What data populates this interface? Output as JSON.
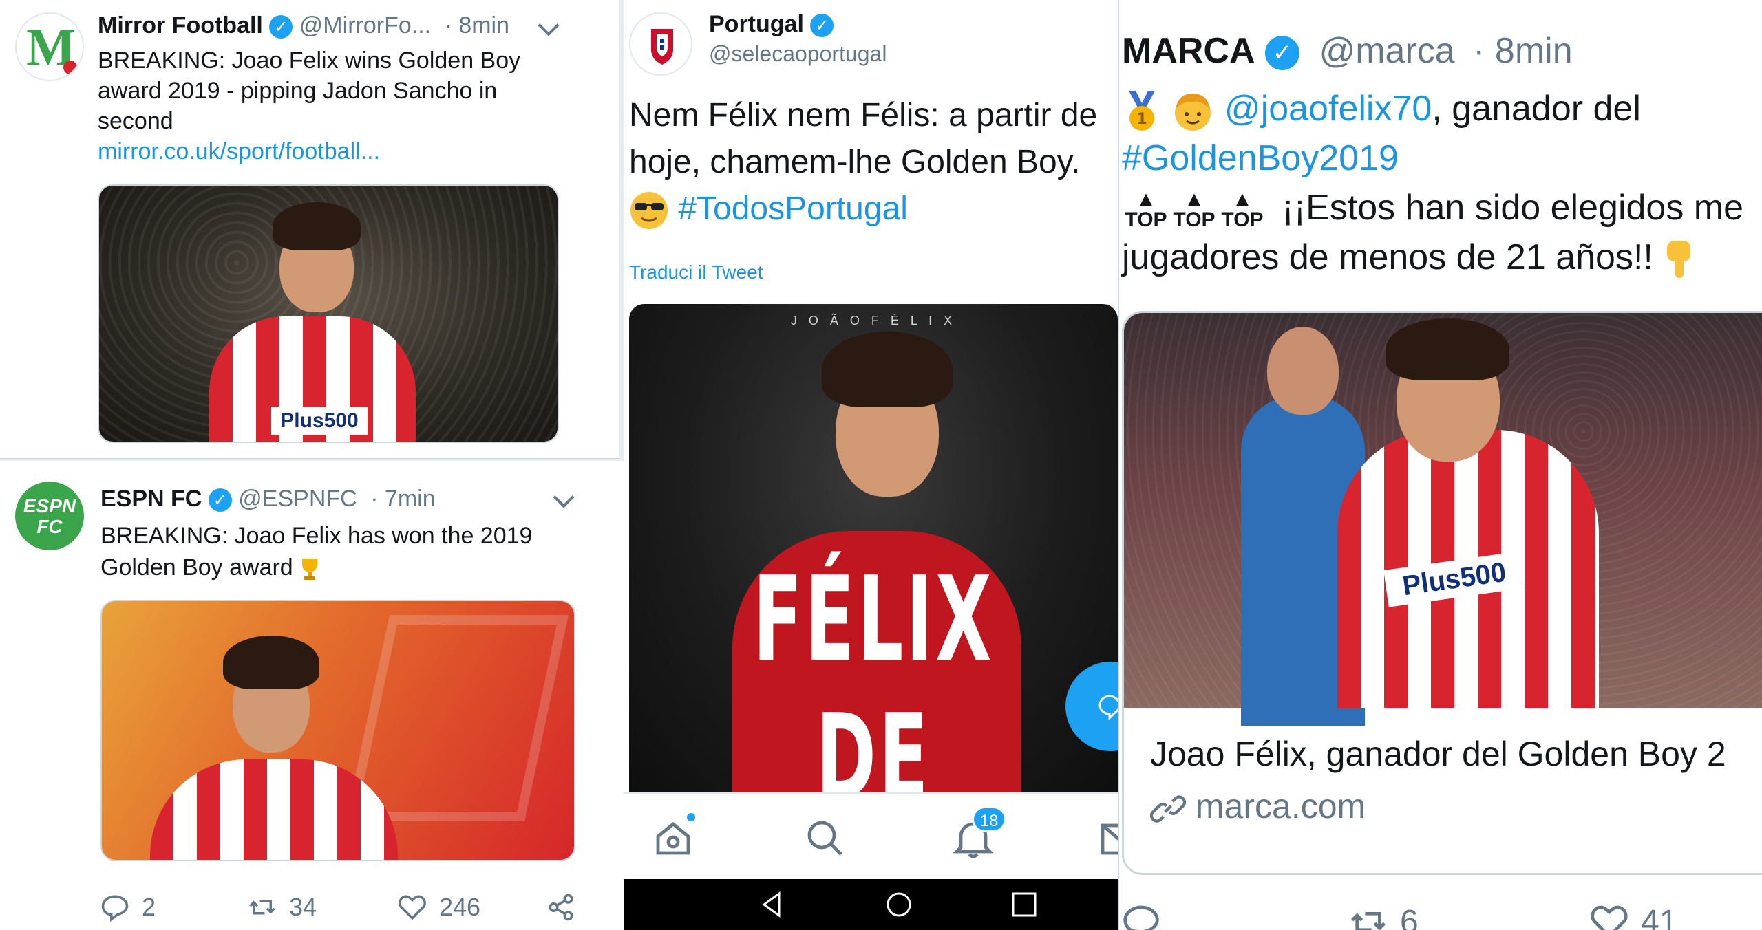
{
  "mirror": {
    "name": "Mirror Football",
    "handle": "@MirrorFo...",
    "time": "· 8min",
    "text1": "BREAKING: Joao Felix wins Golden Boy",
    "text2": "award 2019 - pipping Jadon Sancho in",
    "text3": "second",
    "link": "mirror.co.uk/sport/football...",
    "avatar_letter": "M",
    "sponsor": "Plus500"
  },
  "espn": {
    "name": "ESPN FC",
    "handle": "@ESPNFC",
    "time": "· 7min",
    "text1": "BREAKING: Joao Felix has won the 2019",
    "text2": "Golden Boy award",
    "avatar_text1": "ESPN",
    "avatar_text2": "FC",
    "reply_count": "2",
    "retweet_count": "34",
    "like_count": "246"
  },
  "portugal": {
    "name": "Portugal",
    "handle": "@selecaoportugal",
    "text1": "Nem Félix nem Félis: a partir de",
    "text2": "hoje, chamem-lhe Golden Boy.",
    "hashtag": "#TodosPortugal",
    "translate": "Traduci il Tweet",
    "poster_top": "J O Ã O     F É L I X",
    "poster_line1": "FÉLIX",
    "poster_line2": "DE OURO",
    "notif_count": "18"
  },
  "marca": {
    "name": "MARCA",
    "handle": "@marca",
    "time": "· 8min",
    "mention": "@joaofelix70",
    "text_after_mention": ", ganador del",
    "hashtag": "#GoldenBoy2019",
    "top_label": "TOP",
    "text3": "¡¡Estos han sido elegidos me",
    "text4": "jugadores de menos de 21 años!!",
    "card_title": "Joao Félix, ganador del Golden Boy 2",
    "card_domain": "marca.com",
    "sponsor": "Plus500",
    "retweet_count": "6",
    "like_count": "41"
  },
  "colors": {
    "twitter_blue": "#1da1f2",
    "link_blue": "#1b95e0",
    "espn_green": "#3aa54a",
    "atletico_red": "#d8242f"
  }
}
